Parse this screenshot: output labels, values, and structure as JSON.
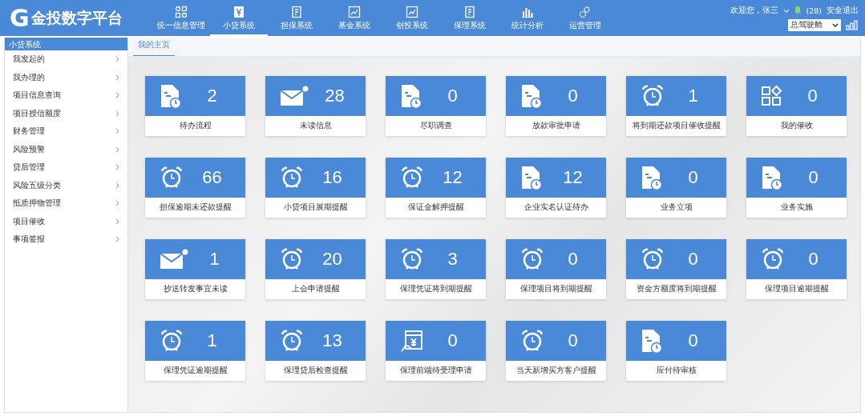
{
  "logo": {
    "mark": "G",
    "title": "金投数字平台"
  },
  "nav": [
    {
      "label": "统一信息管理",
      "kind": "apps",
      "selected": false
    },
    {
      "label": "小贷系统",
      "kind": "yen",
      "selected": true
    },
    {
      "label": "担保系统",
      "kind": "doc",
      "selected": false
    },
    {
      "label": "基金系统",
      "kind": "trend",
      "selected": false
    },
    {
      "label": "创投系统",
      "kind": "trend",
      "selected": false
    },
    {
      "label": "保理系统",
      "kind": "doc",
      "selected": false
    },
    {
      "label": "统计分析",
      "kind": "bars",
      "selected": false
    },
    {
      "label": "运营管理",
      "kind": "gears",
      "selected": false
    }
  ],
  "user": {
    "greeting": "欢迎您，张三",
    "notifications": "(28)",
    "logout": "安全退出",
    "cockpit": "总驾驶舱"
  },
  "sidebar": {
    "title": "小贷系统",
    "items": [
      {
        "label": "我发起的"
      },
      {
        "label": "我办理的"
      },
      {
        "label": "项目信息查询"
      },
      {
        "label": "项目授信额度"
      },
      {
        "label": "财务管理"
      },
      {
        "label": "风险预警"
      },
      {
        "label": "贷后管理"
      },
      {
        "label": "风险五级分类"
      },
      {
        "label": "抵质押物管理"
      },
      {
        "label": "项目催收"
      },
      {
        "label": "事项签报"
      }
    ]
  },
  "tabs": [
    {
      "label": "我的主页",
      "selected": true
    }
  ],
  "tiles": [
    {
      "kind": "docclock",
      "count": "2",
      "label": "待办流程"
    },
    {
      "kind": "mail",
      "count": "28",
      "label": "未读信息"
    },
    {
      "kind": "docclock",
      "count": "0",
      "label": "尽职调查"
    },
    {
      "kind": "docclock",
      "count": "0",
      "label": "放款审批申请"
    },
    {
      "kind": "alarm",
      "count": "1",
      "label": "将到期还款项目催收提醒"
    },
    {
      "kind": "apps",
      "count": "0",
      "label": "我的催收"
    },
    {
      "kind": "alarm",
      "count": "66",
      "label": "担保逾期未还款提醒"
    },
    {
      "kind": "alarm",
      "count": "16",
      "label": "小贷项目展期提醒"
    },
    {
      "kind": "alarm",
      "count": "12",
      "label": "保证金解押提醒"
    },
    {
      "kind": "docclock",
      "count": "12",
      "label": "企业实名认证待办"
    },
    {
      "kind": "docclock",
      "count": "0",
      "label": "业务立项"
    },
    {
      "kind": "docclock",
      "count": "0",
      "label": "业务实施"
    },
    {
      "kind": "mail",
      "count": "1",
      "label": "抄送转发事宜未读"
    },
    {
      "kind": "alarm",
      "count": "20",
      "label": "上会申请提醒"
    },
    {
      "kind": "alarm",
      "count": "3",
      "label": "保理凭证将到期提醒"
    },
    {
      "kind": "alarm",
      "count": "0",
      "label": "保理项目将到期提醒"
    },
    {
      "kind": "alarm",
      "count": "0",
      "label": "资金方额度将到期提醒"
    },
    {
      "kind": "alarm",
      "count": "0",
      "label": "保理项目逾期提醒"
    },
    {
      "kind": "alarm",
      "count": "1",
      "label": "保理凭证逾期提醒"
    },
    {
      "kind": "alarm",
      "count": "13",
      "label": "保理贷后检查提醒"
    },
    {
      "kind": "pay",
      "count": "0",
      "label": "保理前端待受理申请"
    },
    {
      "kind": "alarm",
      "count": "0",
      "label": "当天新增买方客户提醒"
    },
    {
      "kind": "docclock",
      "count": "0",
      "label": "应付待审核"
    }
  ]
}
